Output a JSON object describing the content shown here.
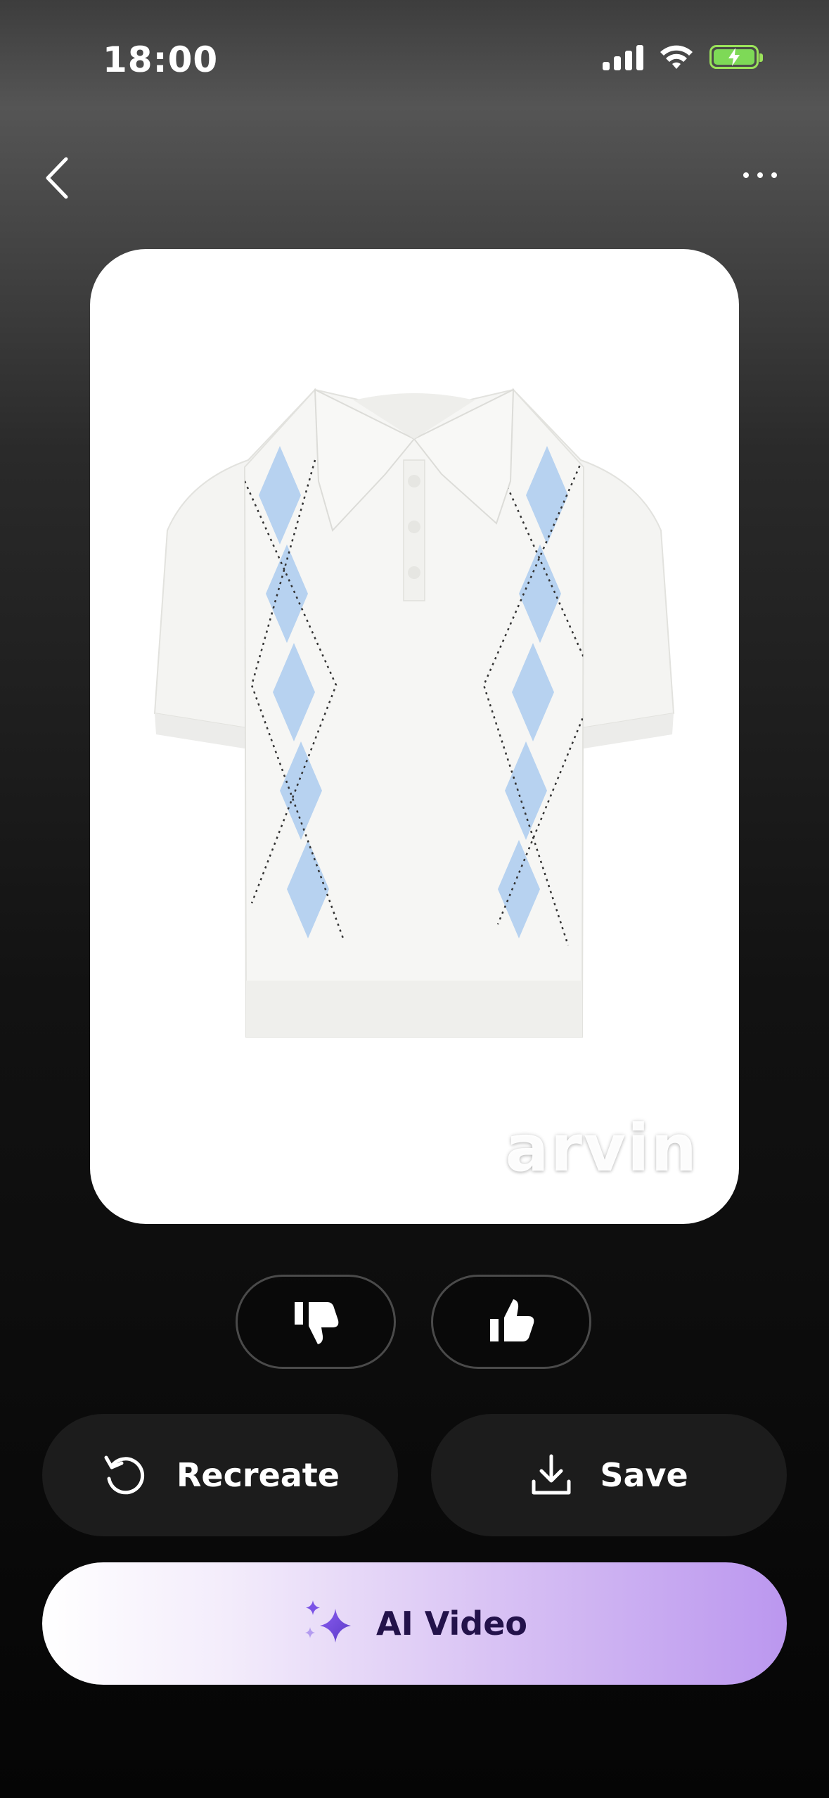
{
  "status_bar": {
    "time": "18:00"
  },
  "image": {
    "watermark": "arvin"
  },
  "actions": {
    "recreate_label": "Recreate",
    "save_label": "Save",
    "ai_video_label": "AI Video"
  },
  "colors": {
    "ai_gradient_start": "#ffffff",
    "ai_gradient_end": "#bb97ef",
    "battery": "#7ed957"
  },
  "icons": [
    "back-chevron-icon",
    "more-dots-icon",
    "thumbs-down-icon",
    "thumbs-up-icon",
    "refresh-icon",
    "download-icon",
    "sparkle-icon"
  ]
}
